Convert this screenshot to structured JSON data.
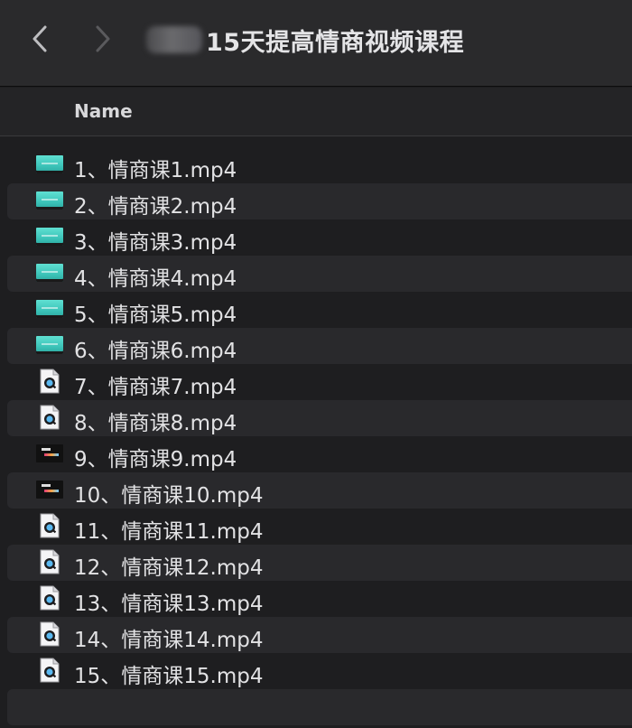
{
  "window": {
    "title": "15天提高情商视频课程"
  },
  "header": {
    "name_column": "Name"
  },
  "files": [
    {
      "name": "1、情商课1.mp4",
      "icon": "video-thumbnail-teal"
    },
    {
      "name": "2、情商课2.mp4",
      "icon": "video-thumbnail-teal"
    },
    {
      "name": "3、情商课3.mp4",
      "icon": "video-thumbnail-teal"
    },
    {
      "name": "4、情商课4.mp4",
      "icon": "video-thumbnail-teal"
    },
    {
      "name": "5、情商课5.mp4",
      "icon": "video-thumbnail-teal"
    },
    {
      "name": "6、情商课6.mp4",
      "icon": "video-thumbnail-teal"
    },
    {
      "name": "7、情商课7.mp4",
      "icon": "quicktime-file-icon"
    },
    {
      "name": "8、情商课8.mp4",
      "icon": "quicktime-file-icon"
    },
    {
      "name": "9、情商课9.mp4",
      "icon": "video-thumbnail-dark"
    },
    {
      "name": "10、情商课10.mp4",
      "icon": "video-thumbnail-dark"
    },
    {
      "name": "11、情商课11.mp4",
      "icon": "quicktime-file-icon"
    },
    {
      "name": "12、情商课12.mp4",
      "icon": "quicktime-file-icon"
    },
    {
      "name": "13、情商课13.mp4",
      "icon": "quicktime-file-icon"
    },
    {
      "name": "14、情商课14.mp4",
      "icon": "quicktime-file-icon"
    },
    {
      "name": "15、情商课15.mp4",
      "icon": "quicktime-file-icon"
    }
  ],
  "colors": {
    "background": "#1e1e20",
    "toolbar": "#2a2a2c",
    "row_alt": "#29292c",
    "text": "#e2e2e4"
  }
}
